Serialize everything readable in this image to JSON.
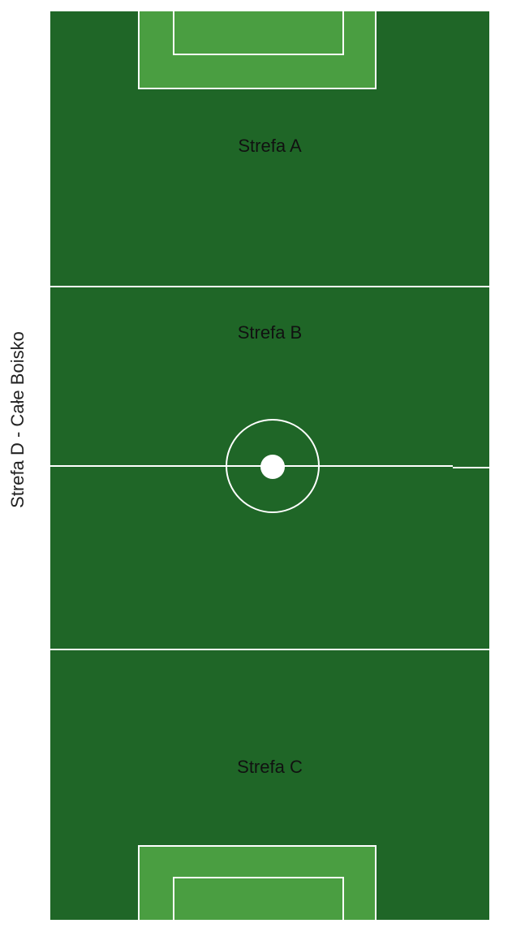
{
  "zones": {
    "a_label": "Strefa A",
    "b_label": "Strefa B",
    "c_label": "Strefa C",
    "d_label": "Strefa D - Całe Boisko"
  },
  "colors": {
    "pitch": "#1f6627",
    "box_fill": "#4a9e41",
    "lines": "#ffffff"
  }
}
